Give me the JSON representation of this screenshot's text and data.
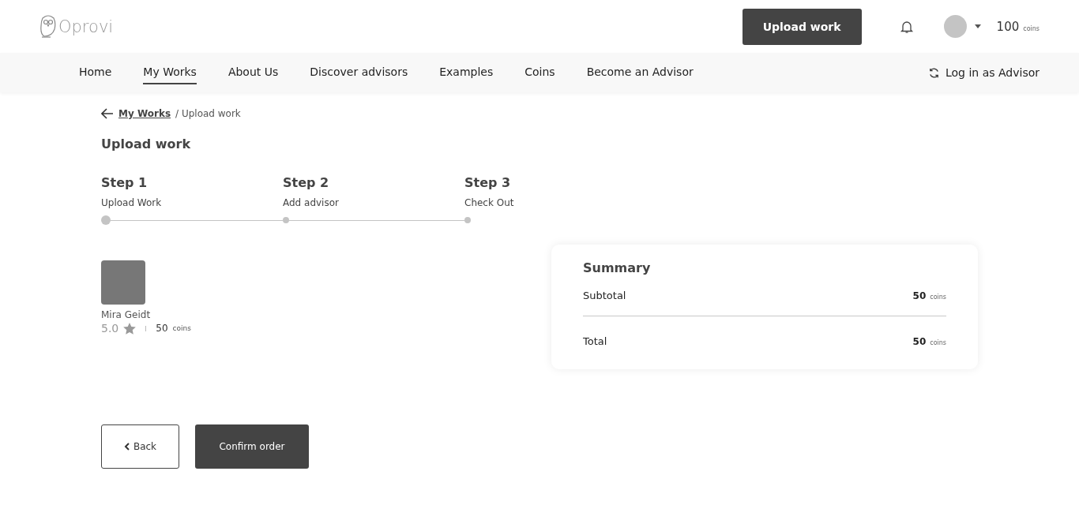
{
  "header": {
    "logo": "Oprovi",
    "upload_button": "Upload work",
    "coins_amount": "100",
    "coins_unit": "coins"
  },
  "nav": {
    "items": [
      {
        "label": "Home",
        "selected": false
      },
      {
        "label": "My Works",
        "selected": true
      },
      {
        "label": "About Us",
        "selected": false
      },
      {
        "label": "Discover advisors",
        "selected": false
      },
      {
        "label": "Examples",
        "selected": false
      },
      {
        "label": "Coins",
        "selected": false
      },
      {
        "label": "Become an Advisor",
        "selected": false
      }
    ],
    "switch_link": "Log in as Advisor"
  },
  "breadcrumb": {
    "link": "My Works",
    "current": "/ Upload work"
  },
  "page_title": "Upload work",
  "steps": [
    {
      "title": "Step 1",
      "label": "Upload Work",
      "selected": true
    },
    {
      "title": "Step 2",
      "label": "Add advisor",
      "selected": false
    },
    {
      "title": "Step 3",
      "label": "Check Out",
      "selected": false
    }
  ],
  "advisor": {
    "name": "Mira Geidt",
    "rating": "5.0",
    "price": "50",
    "price_unit": "coins"
  },
  "summary": {
    "title": "Summary",
    "rows": [
      {
        "label": "Subtotal",
        "amount": "50",
        "unit": "coins"
      },
      {
        "label": "Total",
        "amount": "50",
        "unit": "coins"
      }
    ]
  },
  "buttons": {
    "back": "Back",
    "confirm": "Confirm order"
  }
}
